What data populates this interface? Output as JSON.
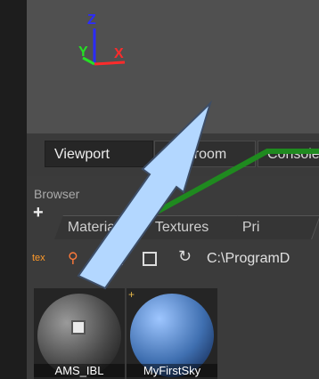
{
  "viewport": {
    "axes": {
      "z": "Z",
      "y": "Y",
      "x": "X"
    },
    "axis_colors": {
      "z": "#2b2bff",
      "y": "#25e025",
      "x": "#ff2b2b"
    }
  },
  "tabs": [
    {
      "label": "Viewport",
      "active": true
    },
    {
      "label": "Darkroom",
      "active": false
    },
    {
      "label": "Console",
      "active": false
    }
  ],
  "browser": {
    "title": "Browser",
    "add_label": "+",
    "tabs": [
      "Materials",
      "Textures",
      "Pri"
    ],
    "toolbar": {
      "tex_label": "tex",
      "path": "C:\\ProgramD"
    },
    "items": [
      {
        "name": "AMS_IBL"
      },
      {
        "name": "MyFirstSky"
      }
    ]
  },
  "annotations": {
    "arrow_fill": "#b3d7ff",
    "line_color": "#1f8a1f"
  }
}
